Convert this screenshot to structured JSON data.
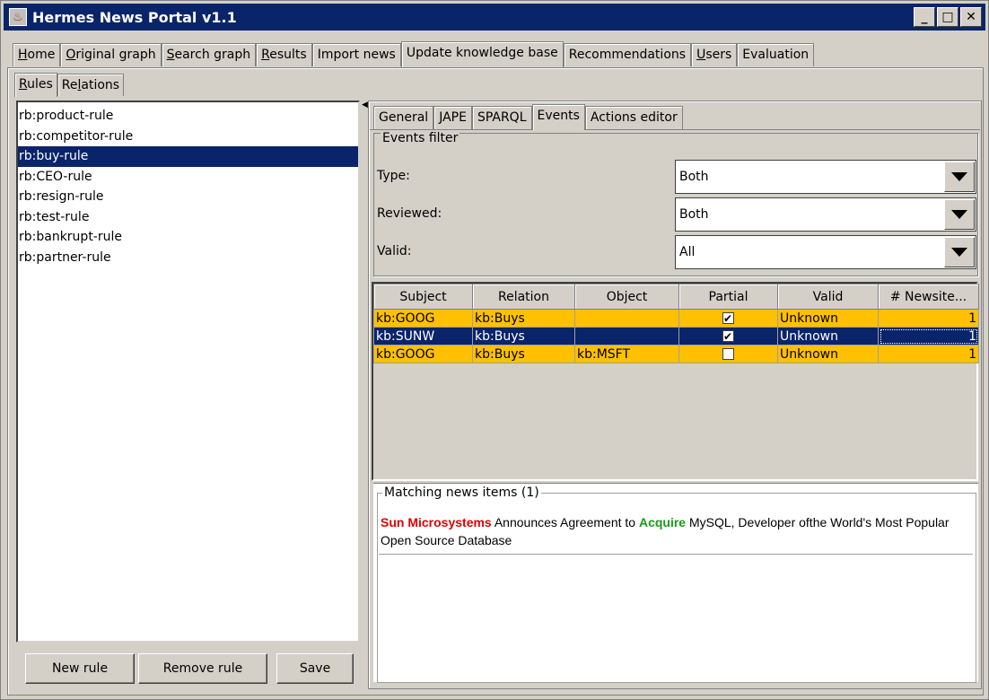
{
  "window": {
    "title": "Hermes News Portal v1.1",
    "icon": "java-cup-icon",
    "controls": {
      "minimize": "_",
      "maximize": "□",
      "close": "✕"
    }
  },
  "main_tabs": [
    {
      "label": "Home",
      "underline": "H",
      "rest": "ome"
    },
    {
      "label": "Original graph",
      "underline": "O",
      "rest": "riginal graph"
    },
    {
      "label": "Search graph",
      "underline": "S",
      "rest": "earch graph"
    },
    {
      "label": "Results",
      "underline": "R",
      "rest": "esults"
    },
    {
      "label": "Import news",
      "underline": "",
      "rest": "Import news"
    },
    {
      "label": "Update knowledge base",
      "underline": "",
      "rest": "Update knowledge base",
      "selected": true
    },
    {
      "label": "Recommendations",
      "underline": "",
      "rest": "Recommendations"
    },
    {
      "label": "Users",
      "underline": "U",
      "rest": "sers"
    },
    {
      "label": "Evaluation",
      "underline": "",
      "rest": "Evaluation"
    }
  ],
  "sub_tabs": [
    {
      "label": "Rules",
      "underline": "R",
      "rest": "ules",
      "selected": true
    },
    {
      "label": "Relations",
      "pre": "Re",
      "underline": "l",
      "rest": "ations"
    }
  ],
  "rules": [
    "rb:product-rule",
    "rb:competitor-rule",
    "rb:buy-rule",
    "rb:CEO-rule",
    "rb:resign-rule",
    "rb:test-rule",
    "rb:bankrupt-rule",
    "rb:partner-rule"
  ],
  "selected_rule": "rb:buy-rule",
  "rule_buttons": {
    "new": "New rule",
    "remove": "Remove rule",
    "save": "Save"
  },
  "right_tabs": [
    "General",
    "JAPE",
    "SPARQL",
    "Events",
    "Actions editor"
  ],
  "right_tab_selected": "Events",
  "events_filter": {
    "legend": "Events filter",
    "type_label": "Type:",
    "type_value": "Both",
    "reviewed_label": "Reviewed:",
    "reviewed_value": "Both",
    "valid_label": "Valid:",
    "valid_value": "All"
  },
  "table": {
    "columns": [
      "Subject",
      "Relation",
      "Object",
      "Partial",
      "Valid",
      "# Newsite..."
    ],
    "rows": [
      {
        "subject": "kb:GOOG",
        "relation": "kb:Buys",
        "object": "",
        "partial": true,
        "valid": "Unknown",
        "count": "1",
        "state": "highlight"
      },
      {
        "subject": "kb:SUNW",
        "relation": "kb:Buys",
        "object": "",
        "partial": true,
        "valid": "Unknown",
        "count": "1",
        "state": "selected"
      },
      {
        "subject": "kb:GOOG",
        "relation": "kb:Buys",
        "object": "kb:MSFT",
        "partial": false,
        "valid": "Unknown",
        "count": "1",
        "state": "highlight"
      }
    ]
  },
  "colors": {
    "highlight_row": "#ffc000",
    "selection": "#0a246a",
    "keyword_subject": "#e00000",
    "keyword_relation": "#1a9a1a"
  },
  "matching_news": {
    "legend": "Matching news items (1)",
    "item": {
      "kw1": "Sun Microsystems",
      "t1": " Announces Agreement to ",
      "kw2": "Acquire",
      "t2": " MySQL, Developer ofthe World's Most Popular Open Source Database"
    }
  }
}
